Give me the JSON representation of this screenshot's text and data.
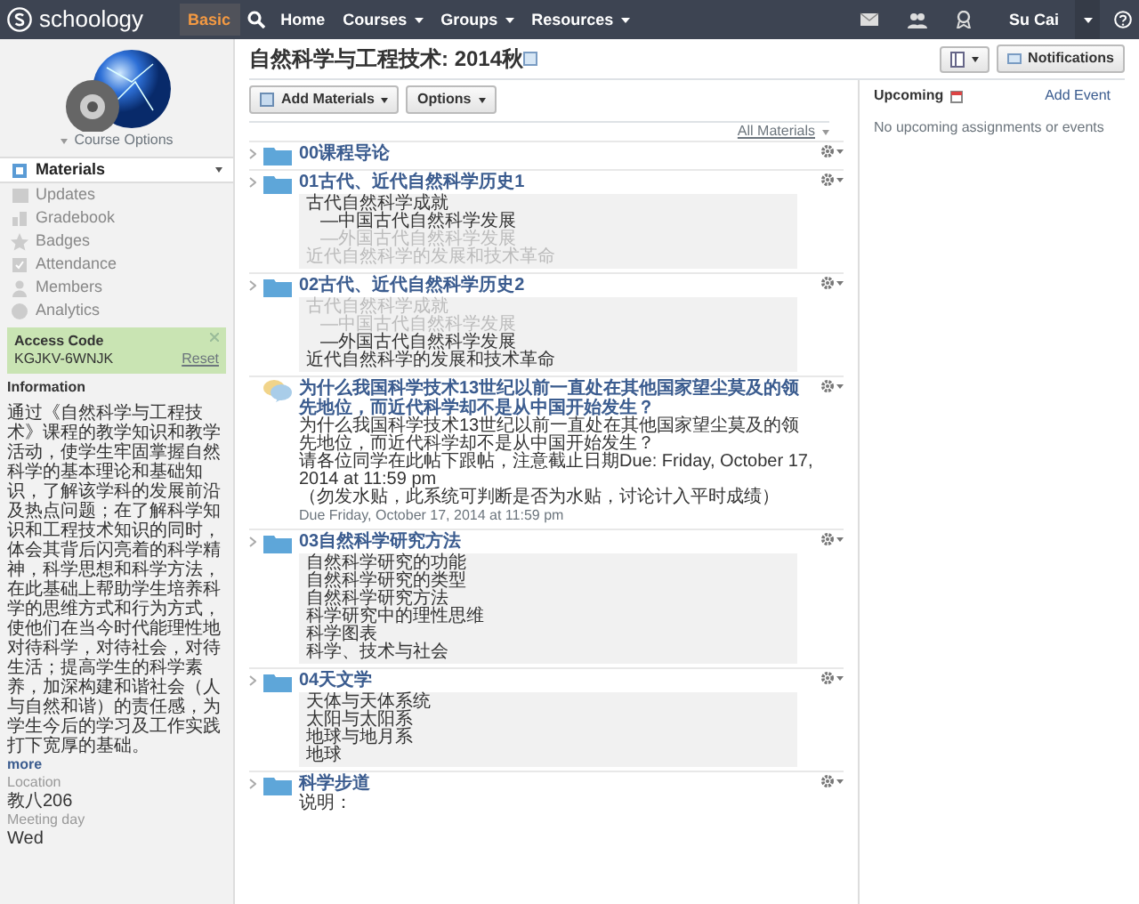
{
  "navbar": {
    "logo": "schoology",
    "items": [
      {
        "label": "Basic",
        "kind": "mode"
      },
      {
        "label": "Home",
        "kind": "link"
      },
      {
        "label": "Courses",
        "kind": "menu"
      },
      {
        "label": "Groups",
        "kind": "menu"
      },
      {
        "label": "Resources",
        "kind": "menu"
      }
    ],
    "user": "Su Cai"
  },
  "sidebar": {
    "course_options": "Course Options",
    "nav": [
      {
        "label": "Materials",
        "selected": true
      },
      {
        "label": "Updates",
        "selected": false
      },
      {
        "label": "Gradebook",
        "selected": false
      },
      {
        "label": "Badges",
        "selected": false
      },
      {
        "label": "Attendance",
        "selected": false
      },
      {
        "label": "Members",
        "selected": false
      },
      {
        "label": "Analytics",
        "selected": false
      }
    ],
    "access_code": {
      "title": "Access Code",
      "code": "KGJKV-6WNJK",
      "reset": "Reset"
    },
    "information": {
      "heading": "Information",
      "text": "通过《自然科学与工程技术》课程的教学知识和教学活动，使学生牢固掌握自然科学的基本理论和基础知识，了解该学科的发展前沿及热点问题；在了解科学知识和工程技术知识的同时，体会其背后闪亮着的科学精神，科学思想和科学方法，在此基础上帮助学生培养科学的思维方式和行为方式，使他们在当今时代能理性地对待科学，对待社会，对待生活；提高学生的科学素养，加深构建和谐社会（人与自然和谐）的责任感，为学生今后的学习及工作实践打下宽厚的基础。",
      "more": "more"
    },
    "details": [
      {
        "label": "Location",
        "value": "教八206"
      },
      {
        "label": "Meeting day",
        "value": "Wed"
      }
    ]
  },
  "course": {
    "title": "自然科学与工程技术: 2014秋",
    "notifications": "Notifications"
  },
  "toolbar": {
    "buttons": [
      "Add Materials",
      "Options"
    ],
    "filter": "All Materials"
  },
  "materials": [
    {
      "kind": "folder",
      "title": "00课程导论"
    },
    {
      "kind": "folder",
      "title": "01古代、近代自然科学历史1",
      "lines": [
        {
          "text": "古代自然科学成就",
          "dimmed": false,
          "children": [
            {
              "text": "—中国古代自然科学发展",
              "dimmed": false
            },
            {
              "text": "—外国古代自然科学发展",
              "dimmed": true
            }
          ]
        },
        {
          "text": "近代自然科学的发展和技术革命",
          "dimmed": true
        }
      ]
    },
    {
      "kind": "folder",
      "title": "02古代、近代自然科学历史2",
      "lines": [
        {
          "text": "古代自然科学成就",
          "dimmed": true,
          "children": [
            {
              "text": "—中国古代自然科学发展",
              "dimmed": true
            },
            {
              "text": "—外国古代自然科学发展",
              "dimmed": false
            }
          ]
        },
        {
          "text": "近代自然科学的发展和技术革命",
          "dimmed": false
        }
      ]
    },
    {
      "kind": "discussion",
      "title": "为什么我国科学技术13世纪以前一直处在其他国家望尘莫及的领先地位，而近代科学却不是从中国开始发生？",
      "body": [
        "为什么我国科学技术13世纪以前一直处在其他国家望尘莫及的领先地位，而近代科学却不是从中国开始发生？",
        "请各位同学在此帖下跟帖，注意截止日期Due: Friday, October 17, 2014 at 11:59 pm",
        "（勿发水贴，此系统可判断是否为水贴，讨论计入平时成绩）"
      ],
      "due": "Due Friday, October 17, 2014 at 11:59 pm"
    },
    {
      "kind": "folder",
      "title": "03自然科学研究方法",
      "lines": [
        {
          "text": "自然科学研究的功能",
          "dimmed": false
        },
        {
          "text": "自然科学研究的类型",
          "dimmed": false
        },
        {
          "text": "自然科学研究方法",
          "dimmed": false
        },
        {
          "text": "科学研究中的理性思维",
          "dimmed": false
        },
        {
          "text": "科学图表",
          "dimmed": false
        },
        {
          "text": "科学、技术与社会",
          "dimmed": false
        }
      ]
    },
    {
      "kind": "folder",
      "title": "04天文学",
      "lines": [
        {
          "text": "天体与天体系统",
          "dimmed": false
        },
        {
          "text": "太阳与太阳系",
          "dimmed": false
        },
        {
          "text": "地球与地月系",
          "dimmed": false
        },
        {
          "text": "地球",
          "dimmed": false
        }
      ]
    },
    {
      "kind": "folder",
      "title": "科学步道",
      "note": "说明："
    }
  ],
  "upcoming": {
    "title": "Upcoming",
    "add": "Add Event",
    "empty": "No upcoming assignments or events"
  }
}
